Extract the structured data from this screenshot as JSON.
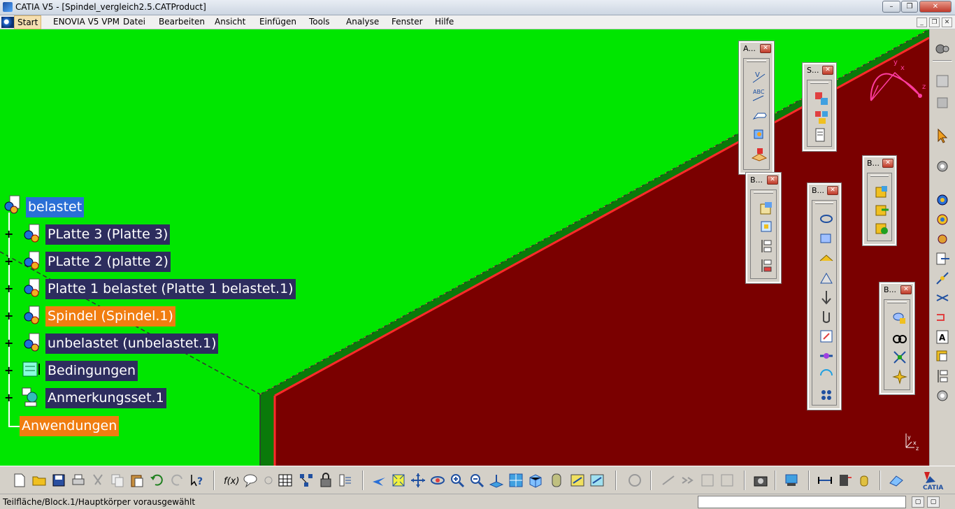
{
  "window": {
    "title": "CATIA V5 - [Spindel_vergleich2.5.CATProduct]"
  },
  "menubar": {
    "items": [
      "Start",
      "ENOVIA V5 VPM",
      "Datei",
      "Bearbeiten",
      "Ansicht",
      "Einfügen",
      "Tools",
      "Analyse",
      "Fenster",
      "Hilfe"
    ]
  },
  "tree": {
    "root": "belastet",
    "nodes": [
      "PLatte 3 (Platte 3)",
      "PLatte 2 (platte 2)",
      "Platte 1 belastet (Platte 1 belastet.1)",
      "Spindel (Spindel.1)",
      "unbelastet (unbelastet.1)",
      "Bedingungen",
      "Anmerkungsset.1"
    ],
    "applications": "Anwendungen"
  },
  "palettes": [
    "A...",
    "S...",
    "B...",
    "B...",
    "B...",
    "B..."
  ],
  "compass": {
    "axis_x": "x",
    "axis_y": "y",
    "axis_z": "z"
  },
  "status": {
    "message": "Teilfläche/Block.1/Hauptkörper vorausgewählt"
  },
  "colors": {
    "background_green": "#00e600",
    "face_red": "#7a0000",
    "tree_label_bg": "#2d2d5e",
    "tree_label_highlight": "#f07d10",
    "tree_root_bg": "#2a6fd6"
  },
  "brand": {
    "logo": "CATIA"
  }
}
